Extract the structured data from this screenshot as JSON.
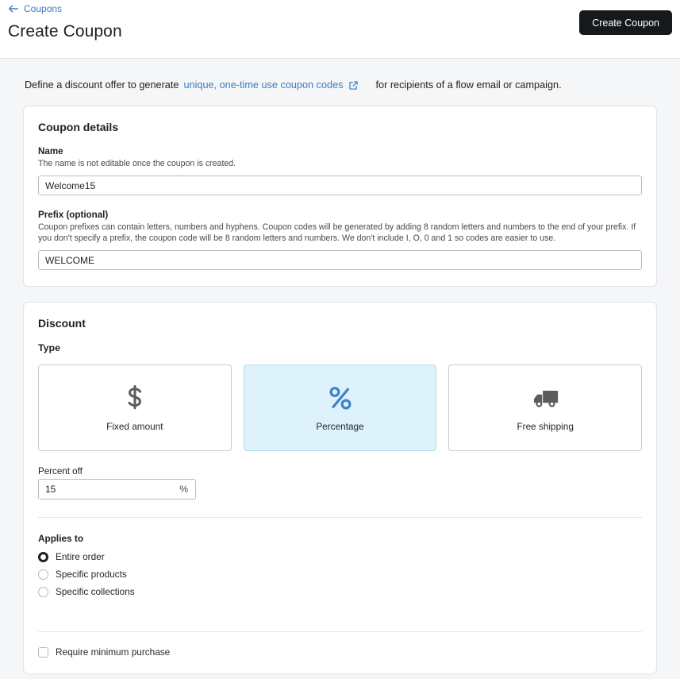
{
  "header": {
    "back_label": "Coupons",
    "back_icon": "arrow-left-icon",
    "title": "Create Coupon",
    "primary_button": "Create Coupon"
  },
  "intro": {
    "lead": "Define a discount offer to generate",
    "link_text": "unique, one-time use coupon codes",
    "link_icon": "external-link-icon",
    "trail": "for recipients of a flow email or campaign."
  },
  "coupon_details": {
    "card_title": "Coupon details",
    "name": {
      "label": "Name",
      "help": "The name is not editable once the coupon is created.",
      "value": "Welcome15",
      "placeholder": ""
    },
    "prefix": {
      "label": "Prefix (optional)",
      "help": "Coupon prefixes can contain letters, numbers and hyphens. Coupon codes will be generated by adding 8 random letters and numbers to the end of your prefix. If you don't specify a prefix, the coupon code will be 8 random letters and numbers. We don't include I, O, 0 and 1 so codes are easier to use.",
      "value": "WELCOME",
      "placeholder": ""
    }
  },
  "discount": {
    "card_title": "Discount",
    "type_label": "Type",
    "types": [
      {
        "label": "Fixed amount",
        "icon": "dollar-sign-icon",
        "selected": false
      },
      {
        "label": "Percentage",
        "icon": "percent-icon",
        "selected": true
      },
      {
        "label": "Free shipping",
        "icon": "truck-icon",
        "selected": false
      }
    ],
    "percent_off": {
      "label": "Percent off",
      "value": "15",
      "suffix": "%"
    },
    "applies_to": {
      "label": "Applies to",
      "options": [
        {
          "label": "Entire order",
          "selected": true
        },
        {
          "label": "Specific products",
          "selected": false
        },
        {
          "label": "Specific collections",
          "selected": false
        }
      ]
    },
    "minimum_purchase": {
      "label": "Require minimum purchase",
      "checked": false
    }
  },
  "colors": {
    "page_bg": "#f5f6f7",
    "card_bg": "#ffffff",
    "link_blue": "#3b7cc4",
    "selected_card_bg": "#ddf2fb",
    "selected_icon_blue": "#3d82c4",
    "icon_gray": "#5a5d60",
    "primary_button_bg": "#16191c"
  }
}
